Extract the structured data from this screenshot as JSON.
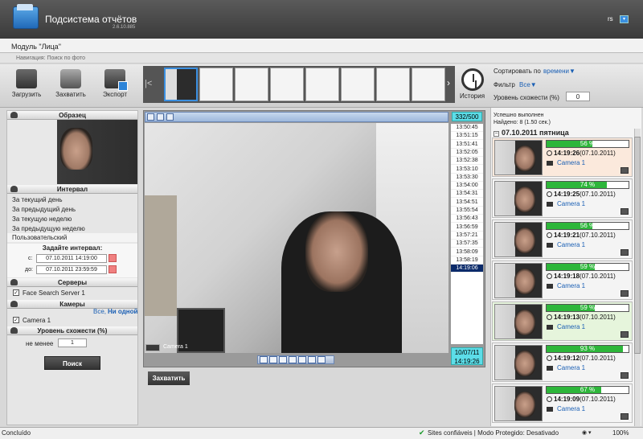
{
  "header": {
    "app_title": "Подсистема отчётов",
    "version": "2.6.10.885",
    "user": "rs",
    "user_menu_icon": "chevron-down-icon"
  },
  "module": {
    "title": "Модуль \"Лица\""
  },
  "nav": {
    "text": "Навигация: Поиск по фото"
  },
  "toolbar": {
    "upload": "Загрузить",
    "capture": "Захватить",
    "export": "Экспорт",
    "history": "История"
  },
  "controls": {
    "sort_label": "Сортировать по",
    "sort_value": "времени▼",
    "filter_label": "Фильтр",
    "filter_value": "Все▼",
    "similarity_label": "Уровень схожести (%)",
    "similarity_value": "0"
  },
  "left": {
    "sample_header": "Образец",
    "interval_header": "Интервал",
    "intervals": [
      "За текущий день",
      "За предыдущий день",
      "За текущую неделю",
      "За предыдущую неделю"
    ],
    "custom": "Пользовательский",
    "set_interval": "Задайте интервал:",
    "from_label": "с:",
    "from_value": "07.10.2011 14:19:00",
    "to_label": "до:",
    "to_value": "07.10.2011 23:59:59",
    "servers_header": "Серверы",
    "server": "Face Search Server 1",
    "cameras_header": "Камеры",
    "cameras_all": "Все,",
    "cameras_none": "Ни одной",
    "camera": "Camera 1",
    "similarity_header": "Уровень схожести (%)",
    "min_label": "не менее",
    "min_value": "1",
    "search_button": "Поиск"
  },
  "video": {
    "frame_counter": "332/500",
    "camera_label": "Camera 1",
    "times": [
      "13:50:45",
      "13:51:15",
      "13:51:41",
      "13:52:05",
      "13:52:38",
      "13:53:10",
      "13:53:30",
      "13:54:00",
      "13:54:31",
      "13:54:51",
      "13:55:54",
      "13:56:43",
      "13:56:59",
      "13:57:21",
      "13:57:35",
      "13:58:09",
      "13:58:19",
      "14:19:06"
    ],
    "selected_time": "14:19:06",
    "date": "10/07/11",
    "time": "14:19:26",
    "capture_button": "Захватить"
  },
  "results": {
    "status": "Успешно выполнен",
    "found": "Найдено: 8 (1.50 сек.)",
    "day": "07.10.2011 пятница",
    "items": [
      {
        "pct": "56 %",
        "value": 56,
        "time": "14:19:26",
        "date": "(07.10.2011)",
        "camera": "Camera 1",
        "bg": "#fbe9dc"
      },
      {
        "pct": "74 %",
        "value": 74,
        "time": "14:19:25",
        "date": "(07.10.2011)",
        "camera": "Camera 1",
        "bg": "#f4f4f4"
      },
      {
        "pct": "56 %",
        "value": 56,
        "time": "14:19:21",
        "date": "(07.10.2011)",
        "camera": "Camera 1",
        "bg": "#f4f4f4"
      },
      {
        "pct": "59 %",
        "value": 59,
        "time": "14:19:18",
        "date": "(07.10.2011)",
        "camera": "Camera 1",
        "bg": "#f4f4f4"
      },
      {
        "pct": "59 %",
        "value": 59,
        "time": "14:19:13",
        "date": "(07.10.2011)",
        "camera": "Camera 1",
        "bg": "#e6f5dc"
      },
      {
        "pct": "93 %",
        "value": 93,
        "time": "14:19:12",
        "date": "(07.10.2011)",
        "camera": "Camera 1",
        "bg": "#f4f4f4"
      },
      {
        "pct": "67 %",
        "value": 67,
        "time": "14:19:09",
        "date": "(07.10.2011)",
        "camera": "Camera 1",
        "bg": "#f4f4f4"
      }
    ]
  },
  "statusbar": {
    "left": "Concluído",
    "mid": "Sites confiáveis | Modo Protegido: Desativado",
    "zoom": "100%"
  }
}
